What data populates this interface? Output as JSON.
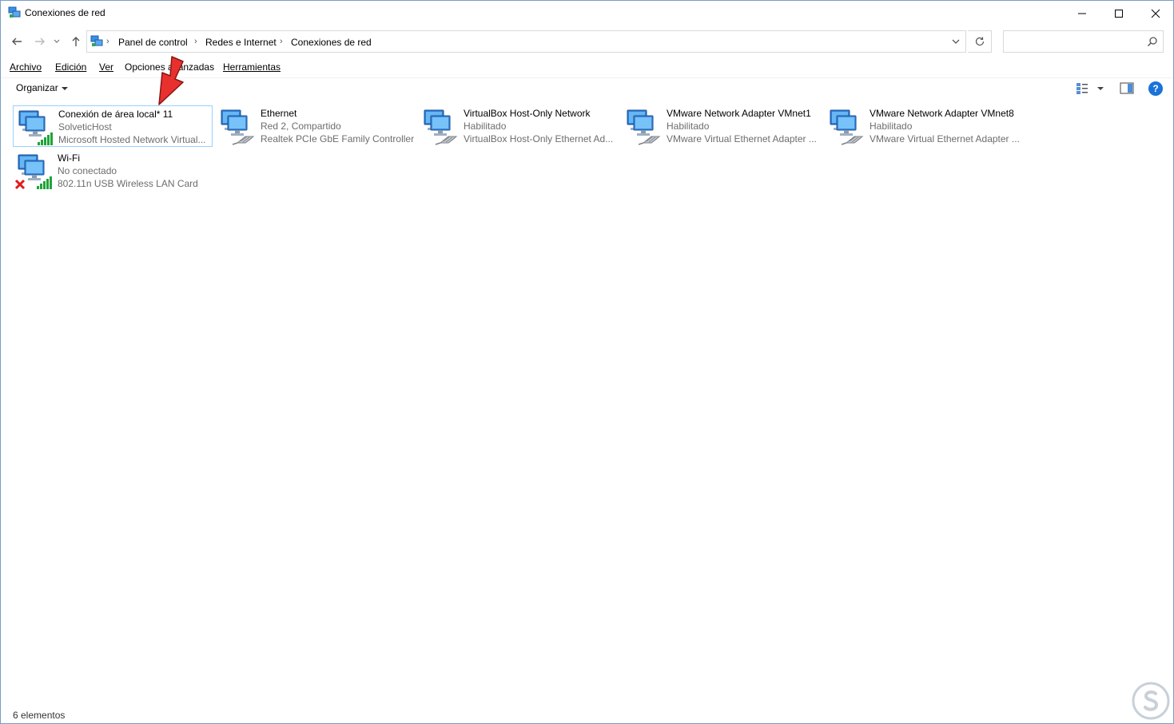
{
  "window": {
    "title": "Conexiones de red",
    "controls": {
      "minimize": "minimize-icon",
      "maximize": "maximize-icon",
      "close": "close-icon"
    }
  },
  "navigation": {
    "breadcrumb": [
      "Panel de control",
      "Redes e Internet",
      "Conexiones de red"
    ],
    "search_placeholder": ""
  },
  "menu": {
    "items": [
      "Archivo",
      "Edición",
      "Ver",
      "Opciones avanzadas",
      "Herramientas"
    ]
  },
  "toolbar": {
    "organize_label": "Organizar",
    "help_label": "?"
  },
  "connections": [
    {
      "name": "Conexión de área local* 11",
      "status": "SolveticHost",
      "device": "Microsoft Hosted Network Virtual...",
      "icon": "wireless-adapter-icon",
      "selected": true
    },
    {
      "name": "Ethernet",
      "status": "Red 2, Compartido",
      "device": "Realtek PCIe GbE Family Controller",
      "icon": "ethernet-adapter-icon"
    },
    {
      "name": "VirtualBox Host-Only Network",
      "status": "Habilitado",
      "device": "VirtualBox Host-Only Ethernet Ad...",
      "icon": "ethernet-adapter-icon"
    },
    {
      "name": "VMware Network Adapter VMnet1",
      "status": "Habilitado",
      "device": "VMware Virtual Ethernet Adapter ...",
      "icon": "ethernet-adapter-icon"
    },
    {
      "name": "VMware Network Adapter VMnet8",
      "status": "Habilitado",
      "device": "VMware Virtual Ethernet Adapter ...",
      "icon": "ethernet-adapter-icon"
    },
    {
      "name": "Wi-Fi",
      "status": "No conectado",
      "device": "802.11n USB Wireless LAN Card",
      "icon": "wireless-disconnected-icon"
    }
  ],
  "statusbar": {
    "item_count": "6 elementos"
  },
  "colors": {
    "accent": "#1a73d9",
    "selection_border": "#99d1ff",
    "annotation_arrow": "#e8312f",
    "signal_green": "#1fa33a",
    "error_red": "#e01b1b"
  }
}
